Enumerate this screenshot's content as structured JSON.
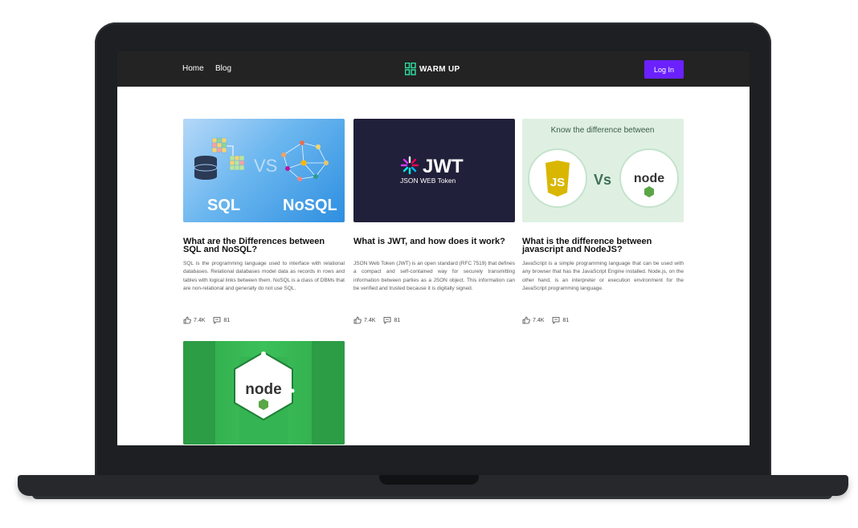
{
  "nav": {
    "links": [
      "Home",
      "Blog"
    ],
    "brand": "WARM UP",
    "login_label": "Log In"
  },
  "cards": [
    {
      "date": "",
      "title": "What are the Differences between SQL and NoSQL?",
      "excerpt": "SQL is the programming language used to interface with relational databases. Relational databases model data as records in rows and tables with logical links between them. NoSQL is a class of DBMs that are non-relational and generally do not use SQL.",
      "likes": "7.4K",
      "comments": "81",
      "thumb_labels": [
        "SQL",
        "VS",
        "NoSQL"
      ]
    },
    {
      "date": "",
      "title": "What is JWT, and how does it work?",
      "excerpt": "JSON Web Token (JWT) is an open standard (RFC 7519) that defines a compact and self-contained way for securely transmitting information between parties as a JSON object. This information can be verified and trusted because it is digitally signed.",
      "likes": "7.4K",
      "comments": "81",
      "thumb_labels": [
        "JWT",
        "JSON WEB Token"
      ]
    },
    {
      "date": "",
      "title": "What is the difference between javascript and NodeJS?",
      "excerpt": "JavaScript is a simple programming language that can be used with any browser that has the JavaScript Engine installed. Node.js, on the other hand, is an interpreter or execution environment for the JavaScript programming language.",
      "likes": "7.4K",
      "comments": "81",
      "thumb_labels": [
        "Know the difference between",
        "JS",
        "Vs",
        "node"
      ]
    },
    {
      "thumb_labels": [
        "node"
      ]
    }
  ],
  "colors": {
    "nav_bg": "#232323",
    "accent": "#6b21ff",
    "brand_icon": "#2ee6a6"
  }
}
